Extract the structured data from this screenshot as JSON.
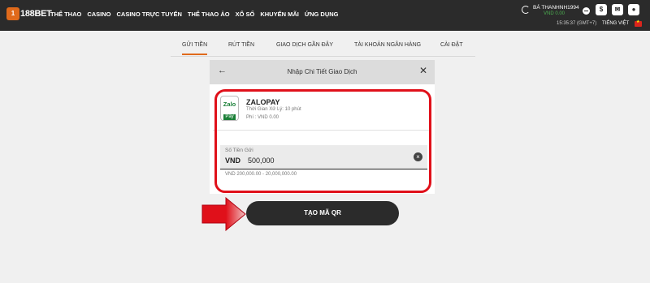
{
  "header": {
    "logo_mark": "1",
    "logo_text": "188BET",
    "nav": [
      "THỂ THAO",
      "CASINO",
      "CASINO TRỰC TUYẾN",
      "THỂ THAO ẢO",
      "XỔ SỐ",
      "KHUYẾN MÃI",
      "ỨNG DỤNG"
    ],
    "username": "BÁ THANHNH1994",
    "balance": "VND 0.00",
    "time": "15:35:37 (GMT+7)",
    "language": "TIẾNG VIỆT"
  },
  "tabs": [
    "GỬI TIỀN",
    "RÚT TIỀN",
    "GIAO DỊCH GẦN ĐÂY",
    "TÀI KHOẢN NGÂN HÀNG",
    "CÀI ĐẶT"
  ],
  "active_tab": "GỬI TIỀN",
  "panel": {
    "title": "Nhập Chi Tiết Giao Dịch",
    "method_name": "ZALOPAY",
    "method_logo_top": "Zalo",
    "method_logo_bottom": "Pay",
    "processing_time": "Thời Gian Xử Lý: 10 phút",
    "fee": "Phí : VND 0.00",
    "amount_label": "Số Tiền Gửi",
    "currency": "VND",
    "amount": "500,000",
    "range": "VND 200,000.00 - 20,000,000.00"
  },
  "submit_label": "TẠO MÃ QR",
  "colors": {
    "brand": "#e06a1b",
    "header_bg": "#2b2b2b",
    "highlight": "#e0101a",
    "zalopay": "#1a7f37"
  }
}
